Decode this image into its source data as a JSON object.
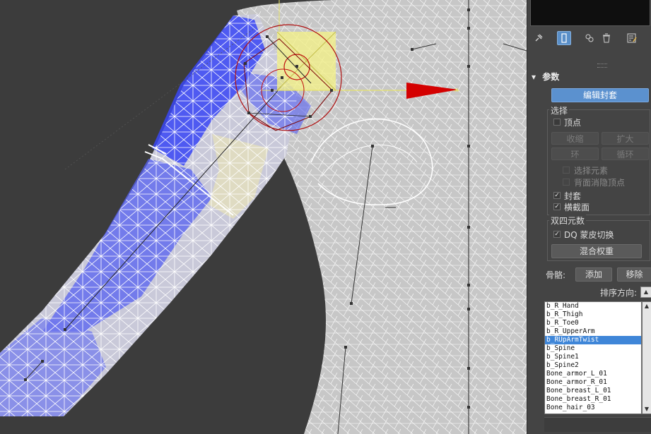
{
  "toolbar": {
    "icons": [
      "pin-icon",
      "modifier-stack-icon",
      "make-unique-icon",
      "delete-icon",
      "configure-icon"
    ]
  },
  "rollout": {
    "title": "参数",
    "collapse_glyph": "▾"
  },
  "edit_envelopes": {
    "label": "编辑封套"
  },
  "select_group": {
    "title": "选择",
    "vertices_label": "顶点",
    "vertices_checked": false,
    "shrink_label": "收缩",
    "grow_label": "扩大",
    "ring_label": "环",
    "loop_label": "循环",
    "select_element_label": "选择元素",
    "backface_cull_label": "背面消隐顶点",
    "envelopes_label": "封套",
    "envelopes_checked": true,
    "cross_sections_label": "横截面",
    "cross_sections_checked": true
  },
  "dq_group": {
    "title": "双四元数",
    "dq_toggle_label": "DQ 蒙皮切换",
    "dq_toggle_checked": true,
    "blend_weights_label": "混合权重"
  },
  "bones": {
    "label": "骨骼:",
    "add_label": "添加",
    "remove_label": "移除",
    "sort_label": "排序方向:",
    "items": [
      "b_R_Hand",
      "b_R_Thigh",
      "b_R_Toe0",
      "b_R_UpperArm",
      "b_RUpArmTwist",
      "b_Spine",
      "b_Spine1",
      "b_Spine2",
      "Bone_armor_L_01",
      "Bone_armor_R_01",
      "Bone_breast_L_01",
      "Bone_breast_R_01",
      "Bone_hair_03"
    ],
    "selected_index": 4
  },
  "colors": {
    "viewport_bg": "#3c3c3c",
    "mesh_gray": "#c9c9c9",
    "weight_blue": "#3c46ff",
    "highlight_yellow": "#f2f08a",
    "gizmo_red": "#c40000",
    "accent_blue": "#5b91cf",
    "selection_blue": "#3f86d8"
  }
}
